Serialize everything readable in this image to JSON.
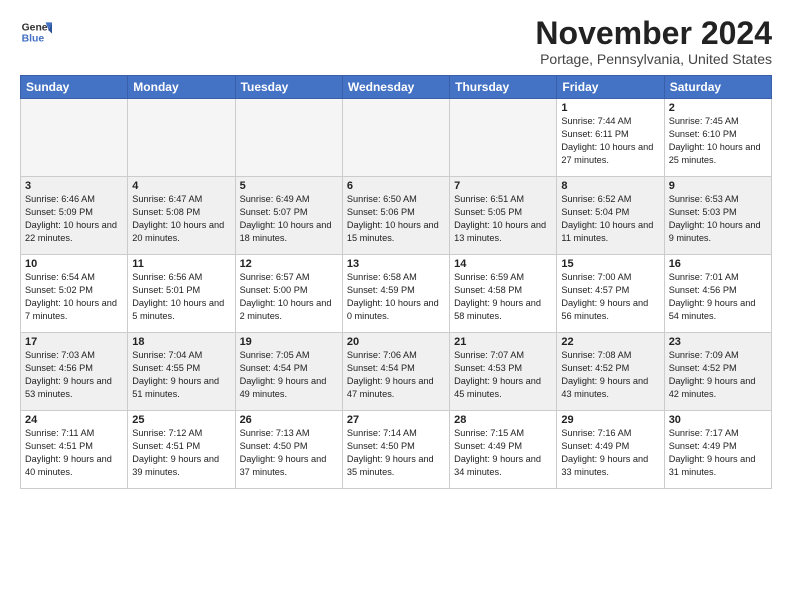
{
  "header": {
    "logo_line1": "General",
    "logo_line2": "Blue",
    "month": "November 2024",
    "location": "Portage, Pennsylvania, United States"
  },
  "weekdays": [
    "Sunday",
    "Monday",
    "Tuesday",
    "Wednesday",
    "Thursday",
    "Friday",
    "Saturday"
  ],
  "weeks": [
    [
      {
        "day": "",
        "info": ""
      },
      {
        "day": "",
        "info": ""
      },
      {
        "day": "",
        "info": ""
      },
      {
        "day": "",
        "info": ""
      },
      {
        "day": "",
        "info": ""
      },
      {
        "day": "1",
        "info": "Sunrise: 7:44 AM\nSunset: 6:11 PM\nDaylight: 10 hours and 27 minutes."
      },
      {
        "day": "2",
        "info": "Sunrise: 7:45 AM\nSunset: 6:10 PM\nDaylight: 10 hours and 25 minutes."
      }
    ],
    [
      {
        "day": "3",
        "info": "Sunrise: 6:46 AM\nSunset: 5:09 PM\nDaylight: 10 hours and 22 minutes."
      },
      {
        "day": "4",
        "info": "Sunrise: 6:47 AM\nSunset: 5:08 PM\nDaylight: 10 hours and 20 minutes."
      },
      {
        "day": "5",
        "info": "Sunrise: 6:49 AM\nSunset: 5:07 PM\nDaylight: 10 hours and 18 minutes."
      },
      {
        "day": "6",
        "info": "Sunrise: 6:50 AM\nSunset: 5:06 PM\nDaylight: 10 hours and 15 minutes."
      },
      {
        "day": "7",
        "info": "Sunrise: 6:51 AM\nSunset: 5:05 PM\nDaylight: 10 hours and 13 minutes."
      },
      {
        "day": "8",
        "info": "Sunrise: 6:52 AM\nSunset: 5:04 PM\nDaylight: 10 hours and 11 minutes."
      },
      {
        "day": "9",
        "info": "Sunrise: 6:53 AM\nSunset: 5:03 PM\nDaylight: 10 hours and 9 minutes."
      }
    ],
    [
      {
        "day": "10",
        "info": "Sunrise: 6:54 AM\nSunset: 5:02 PM\nDaylight: 10 hours and 7 minutes."
      },
      {
        "day": "11",
        "info": "Sunrise: 6:56 AM\nSunset: 5:01 PM\nDaylight: 10 hours and 5 minutes."
      },
      {
        "day": "12",
        "info": "Sunrise: 6:57 AM\nSunset: 5:00 PM\nDaylight: 10 hours and 2 minutes."
      },
      {
        "day": "13",
        "info": "Sunrise: 6:58 AM\nSunset: 4:59 PM\nDaylight: 10 hours and 0 minutes."
      },
      {
        "day": "14",
        "info": "Sunrise: 6:59 AM\nSunset: 4:58 PM\nDaylight: 9 hours and 58 minutes."
      },
      {
        "day": "15",
        "info": "Sunrise: 7:00 AM\nSunset: 4:57 PM\nDaylight: 9 hours and 56 minutes."
      },
      {
        "day": "16",
        "info": "Sunrise: 7:01 AM\nSunset: 4:56 PM\nDaylight: 9 hours and 54 minutes."
      }
    ],
    [
      {
        "day": "17",
        "info": "Sunrise: 7:03 AM\nSunset: 4:56 PM\nDaylight: 9 hours and 53 minutes."
      },
      {
        "day": "18",
        "info": "Sunrise: 7:04 AM\nSunset: 4:55 PM\nDaylight: 9 hours and 51 minutes."
      },
      {
        "day": "19",
        "info": "Sunrise: 7:05 AM\nSunset: 4:54 PM\nDaylight: 9 hours and 49 minutes."
      },
      {
        "day": "20",
        "info": "Sunrise: 7:06 AM\nSunset: 4:54 PM\nDaylight: 9 hours and 47 minutes."
      },
      {
        "day": "21",
        "info": "Sunrise: 7:07 AM\nSunset: 4:53 PM\nDaylight: 9 hours and 45 minutes."
      },
      {
        "day": "22",
        "info": "Sunrise: 7:08 AM\nSunset: 4:52 PM\nDaylight: 9 hours and 43 minutes."
      },
      {
        "day": "23",
        "info": "Sunrise: 7:09 AM\nSunset: 4:52 PM\nDaylight: 9 hours and 42 minutes."
      }
    ],
    [
      {
        "day": "24",
        "info": "Sunrise: 7:11 AM\nSunset: 4:51 PM\nDaylight: 9 hours and 40 minutes."
      },
      {
        "day": "25",
        "info": "Sunrise: 7:12 AM\nSunset: 4:51 PM\nDaylight: 9 hours and 39 minutes."
      },
      {
        "day": "26",
        "info": "Sunrise: 7:13 AM\nSunset: 4:50 PM\nDaylight: 9 hours and 37 minutes."
      },
      {
        "day": "27",
        "info": "Sunrise: 7:14 AM\nSunset: 4:50 PM\nDaylight: 9 hours and 35 minutes."
      },
      {
        "day": "28",
        "info": "Sunrise: 7:15 AM\nSunset: 4:49 PM\nDaylight: 9 hours and 34 minutes."
      },
      {
        "day": "29",
        "info": "Sunrise: 7:16 AM\nSunset: 4:49 PM\nDaylight: 9 hours and 33 minutes."
      },
      {
        "day": "30",
        "info": "Sunrise: 7:17 AM\nSunset: 4:49 PM\nDaylight: 9 hours and 31 minutes."
      }
    ]
  ]
}
